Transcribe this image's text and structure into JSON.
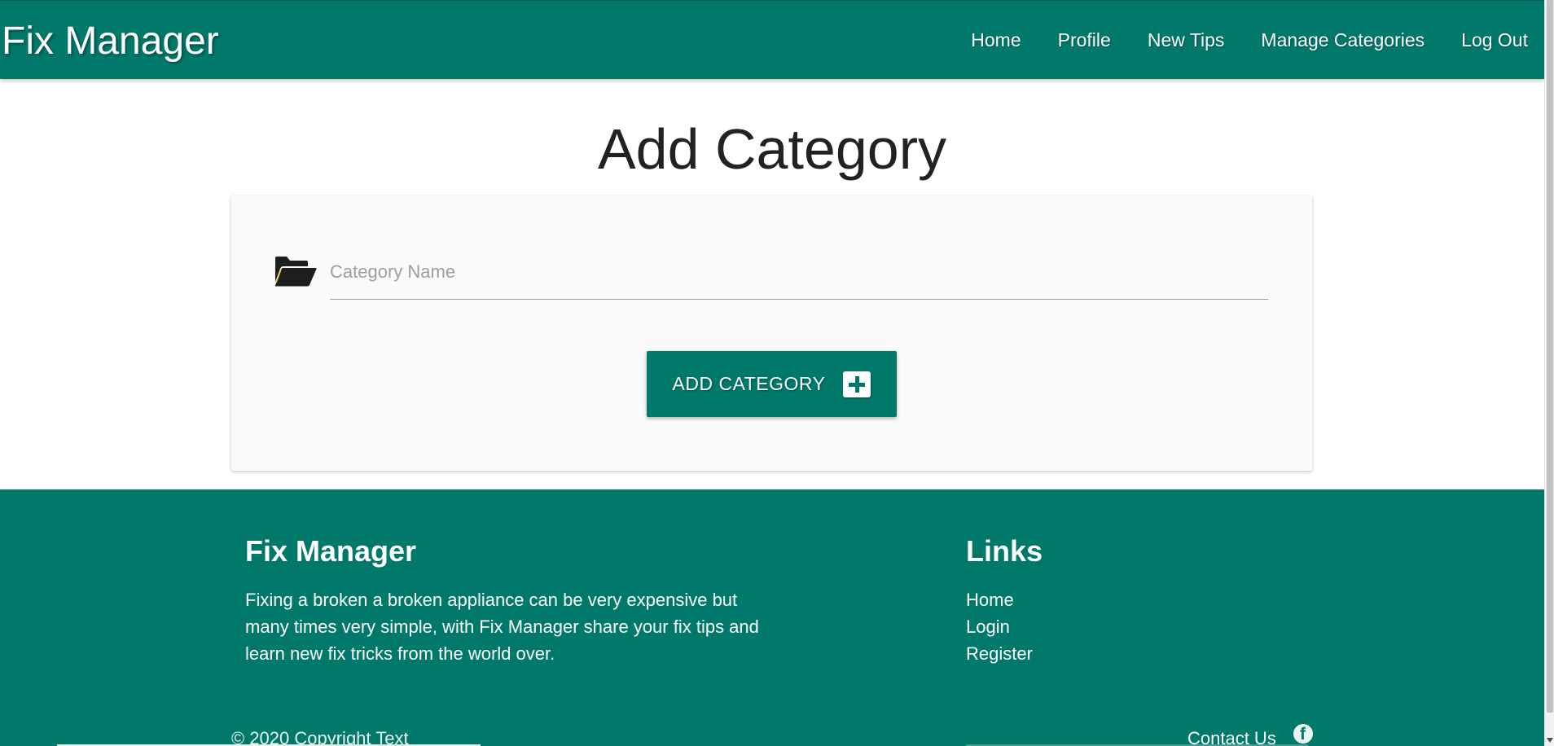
{
  "header": {
    "brand": "Fix Manager",
    "nav": [
      "Home",
      "Profile",
      "New Tips",
      "Manage Categories",
      "Log Out"
    ]
  },
  "main": {
    "title": "Add Category",
    "form": {
      "category_placeholder": "Category Name",
      "category_value": "",
      "submit_label": "ADD CATEGORY"
    }
  },
  "footer": {
    "title": "Fix Manager",
    "description": "Fixing a broken a broken appliance can be very expensive but many times very simple, with Fix Manager share your fix tips and learn new fix tricks from the world over.",
    "links_title": "Links",
    "links": [
      "Home",
      "Login",
      "Register"
    ],
    "copyright": "© 2020 Copyright Text",
    "contact": "Contact Us",
    "social_icon": "facebook-icon"
  },
  "colors": {
    "primary": "#00796b",
    "card_bg": "#fafafa",
    "text": "#222222"
  }
}
